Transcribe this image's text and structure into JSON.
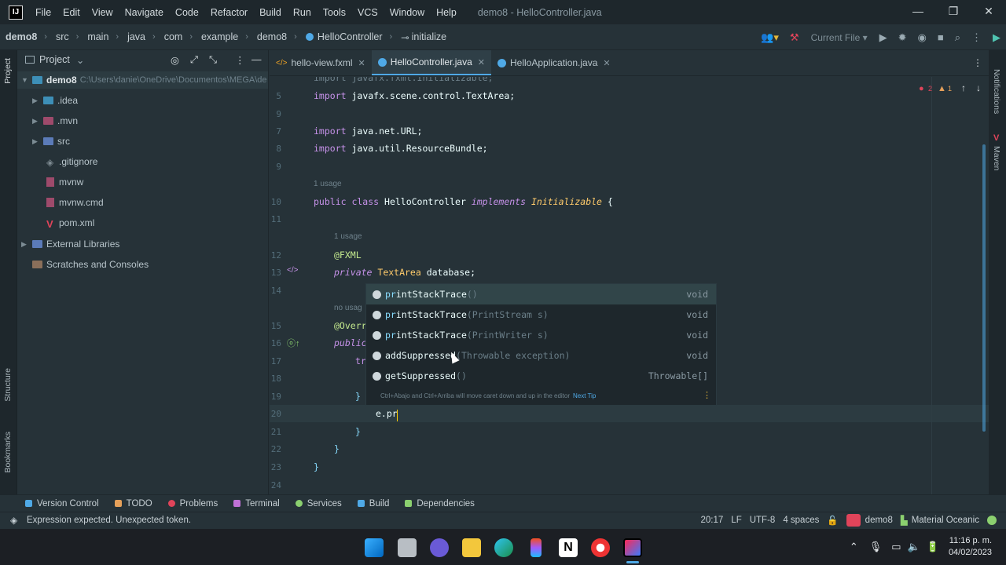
{
  "titlebar": {
    "logo": "IJ",
    "menu": [
      "File",
      "Edit",
      "View",
      "Navigate",
      "Code",
      "Refactor",
      "Build",
      "Run",
      "Tools",
      "VCS",
      "Window",
      "Help"
    ],
    "window_title": "demo8 - HelloController.java",
    "minimize": "—",
    "maximize": "❐",
    "close": "✕"
  },
  "breadcrumb": [
    "demo8",
    "src",
    "main",
    "java",
    "com",
    "example",
    "demo8",
    "HelloController",
    "initialize"
  ],
  "toolbar": {
    "run_config": "Current File"
  },
  "left_stripe": {
    "project": "Project",
    "structure": "Structure",
    "bookmarks": "Bookmarks"
  },
  "right_stripe": {
    "notifications": "Notifications",
    "maven": "Maven"
  },
  "project_panel": {
    "title": "Project",
    "root": {
      "name": "demo8",
      "path": "C:\\Users\\danie\\OneDrive\\Documentos\\MEGA\\de"
    },
    "items": [
      {
        "label": ".idea",
        "kind": "folder",
        "color": "#3d8fb7",
        "expandable": true
      },
      {
        "label": ".mvn",
        "kind": "folder",
        "color": "#9e4a6b",
        "expandable": true
      },
      {
        "label": "src",
        "kind": "folder",
        "color": "#5b7bb8",
        "expandable": true
      },
      {
        "label": ".gitignore",
        "kind": "file",
        "color": "#7f8c93",
        "expandable": false
      },
      {
        "label": "mvnw",
        "kind": "file",
        "color": "#9e4a6b",
        "expandable": false
      },
      {
        "label": "mvnw.cmd",
        "kind": "file",
        "color": "#9e4a6b",
        "expandable": false
      },
      {
        "label": "pom.xml",
        "kind": "file",
        "color": "#e0445a",
        "expandable": false
      }
    ],
    "external_libraries": "External Libraries",
    "scratches": "Scratches and Consoles"
  },
  "editor_tabs": [
    {
      "label": "hello-view.fxml",
      "active": false,
      "color": "#f5a623"
    },
    {
      "label": "HelloController.java",
      "active": true,
      "color": "#4fa9e6"
    },
    {
      "label": "HelloApplication.java",
      "active": false,
      "color": "#4fa9e6"
    }
  ],
  "editor": {
    "inspection": {
      "errors": "2",
      "warnings": "1"
    },
    "lines": {
      "l5": {
        "num": "5",
        "kw": "import",
        "rest": " javafx.scene.control.TextArea;"
      },
      "l7": {
        "num": "7",
        "kw": "import",
        "rest": " java.net.URL;"
      },
      "l8": {
        "num": "8",
        "kw": "import",
        "rest": " java.util.ResourceBundle;"
      },
      "l10": {
        "num": "10",
        "kw1": "public class",
        "name": " HelloController ",
        "kw2": "implements",
        "ty": " Initializable",
        "rest": " {"
      },
      "l12": {
        "num": "12",
        "ann": "@FXML"
      },
      "l13": {
        "num": "13",
        "kw": "private",
        "ty": " TextArea",
        "rest": " database;"
      },
      "l15": {
        "num": "15",
        "ann": "@Overr"
      },
      "l16": {
        "num": "16",
        "kw": "public"
      },
      "l17": {
        "num": "17",
        "kw": "tr"
      },
      "l19": {
        "num": "19",
        "rest": "}"
      },
      "l20": {
        "num": "20",
        "rest": "e.pr"
      },
      "l21": {
        "num": "21",
        "rest": "}"
      },
      "l22": {
        "num": "22",
        "rest": "}"
      },
      "l23": {
        "num": "23",
        "rest": "}"
      }
    },
    "line_numbers_plain": [
      "9",
      "11",
      "14",
      "18",
      "24"
    ],
    "hints": {
      "usage_class": "1 usage",
      "usage_field": "1 usage",
      "no_usages": "no usag"
    }
  },
  "completion": {
    "items": [
      {
        "match": "pr",
        "name": "intStackTrace",
        "params": "()",
        "ret": "void"
      },
      {
        "match": "pr",
        "name": "intStackTrace",
        "params": "(PrintStream s)",
        "ret": "void"
      },
      {
        "match": "pr",
        "name": "intStackTrace",
        "params": "(PrintWriter s)",
        "ret": "void"
      },
      {
        "match": "addSup",
        "name": "pressed",
        "params": "(Throwable exception)",
        "ret": "void"
      },
      {
        "match": "getSup",
        "name": "pressed",
        "params": "()",
        "ret": "Throwable[]"
      }
    ],
    "tip": "Ctrl+Abajo and Ctrl+Arriba will move caret down and up in the editor",
    "tip_link": "Next Tip"
  },
  "bottom_tools": [
    {
      "label": "Version Control",
      "color": "#4fa9e6"
    },
    {
      "label": "TODO",
      "color": "#e5a05a"
    },
    {
      "label": "Problems",
      "color": "#e0445a"
    },
    {
      "label": "Terminal",
      "color": "#c071d6"
    },
    {
      "label": "Services",
      "color": "#8bd06f"
    },
    {
      "label": "Build",
      "color": "#4fa9e6"
    },
    {
      "label": "Dependencies",
      "color": "#8bd06f"
    }
  ],
  "status": {
    "message": "Expression expected. Unexpected token.",
    "position": "20:17",
    "line_sep": "LF",
    "encoding": "UTF-8",
    "indent": "4 spaces",
    "project": "demo8",
    "theme": "Material Oceanic"
  },
  "taskbar": {
    "time": "11:16 p. m.",
    "date": "04/02/2023"
  }
}
